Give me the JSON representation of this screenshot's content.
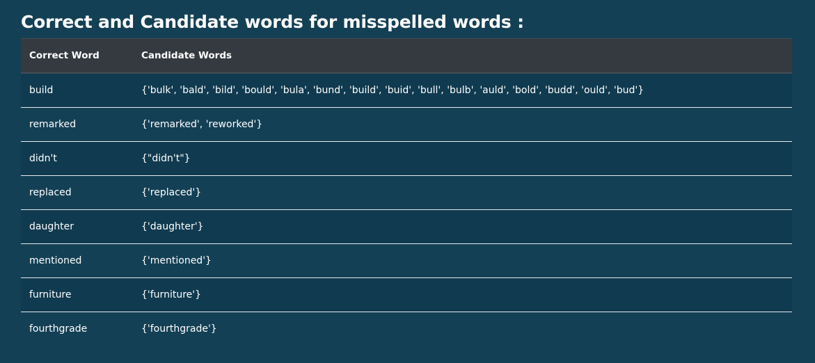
{
  "page": {
    "title": "Correct and Candidate words for misspelled words :"
  },
  "table": {
    "headers": [
      "Correct Word",
      "Candidate Words"
    ],
    "rows": [
      {
        "correct": "build",
        "candidates": "{'bulk', 'bald', 'bild', 'bould', 'bula', 'bund', 'build', 'buid', 'bull', 'bulb', 'auld', 'bold', 'budd', 'ould', 'bud'}"
      },
      {
        "correct": "remarked",
        "candidates": "{'remarked', 'reworked'}"
      },
      {
        "correct": "didn't",
        "candidates": "{\"didn't\"}"
      },
      {
        "correct": "replaced",
        "candidates": "{'replaced'}"
      },
      {
        "correct": "daughter",
        "candidates": "{'daughter'}"
      },
      {
        "correct": "mentioned",
        "candidates": "{'mentioned'}"
      },
      {
        "correct": "furniture",
        "candidates": "{'furniture'}"
      },
      {
        "correct": "fourthgrade",
        "candidates": "{'fourthgrade'}"
      }
    ]
  },
  "colors": {
    "background": "#144055",
    "row_alt": "#103a4f",
    "header_bg": "#343a40",
    "text": "#ffffff"
  }
}
